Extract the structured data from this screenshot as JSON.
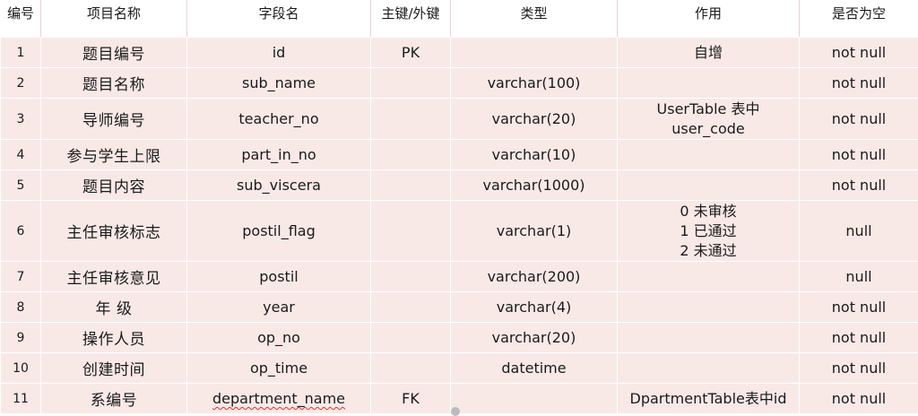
{
  "table": {
    "headers": {
      "num": "编号",
      "name": "项目名称",
      "field": "字段名",
      "key": "主键/外键",
      "type": "类型",
      "role": "作用",
      "nullable": "是否为空"
    },
    "rows": [
      {
        "num": "1",
        "name": "题目编号",
        "field": "id",
        "key": "PK",
        "type": "",
        "role": [
          "自增"
        ],
        "nullable": "not null"
      },
      {
        "num": "2",
        "name": "题目名称",
        "field": "sub_name",
        "key": "",
        "type": "varchar(100)",
        "role": [],
        "nullable": "not null"
      },
      {
        "num": "3",
        "name": "导师编号",
        "field": "teacher_no",
        "key": "",
        "type": "varchar(20)",
        "role": [
          "UserTable 表中",
          "user_code"
        ],
        "nullable": "not null"
      },
      {
        "num": "4",
        "name": "参与学生上限",
        "field": "part_in_no",
        "key": "",
        "type": "varchar(10)",
        "role": [],
        "nullable": "not null"
      },
      {
        "num": "5",
        "name": "题目内容",
        "field": "sub_viscera",
        "key": "",
        "type": "varchar(1000)",
        "role": [],
        "nullable": "not null"
      },
      {
        "num": "6",
        "name": "主任审核标志",
        "field": "postil_flag",
        "key": "",
        "type": "varchar(1)",
        "role": [
          "0 未审核",
          "1 已通过",
          "2 未通过"
        ],
        "nullable": "null"
      },
      {
        "num": "7",
        "name": "主任审核意见",
        "field": "postil",
        "key": "",
        "type": "varchar(200)",
        "role": [],
        "nullable": "null"
      },
      {
        "num": "8",
        "name": "年 级",
        "field": "year",
        "key": "",
        "type": "varchar(4)",
        "role": [],
        "nullable": "not null"
      },
      {
        "num": "9",
        "name": "操作人员",
        "field": "op_no",
        "key": "",
        "type": "varchar(20)",
        "role": [],
        "nullable": "not null"
      },
      {
        "num": "10",
        "name": "创建时间",
        "field": "op_time",
        "key": "",
        "type": "datetime",
        "role": [],
        "nullable": "not null"
      },
      {
        "num": "11",
        "name": "系编号",
        "field": "department_name",
        "key": "FK",
        "type": "",
        "role": [
          "DpartmentTable表中id"
        ],
        "nullable": "not null"
      }
    ]
  }
}
